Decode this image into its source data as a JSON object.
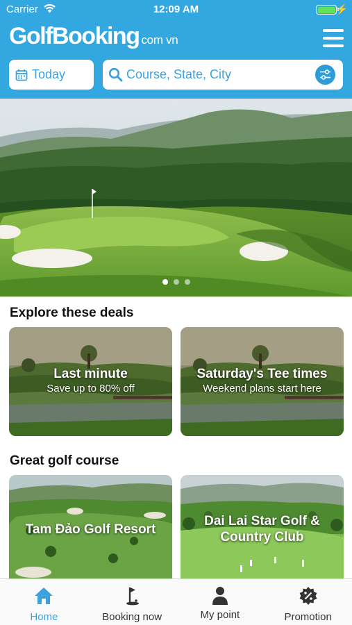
{
  "status_bar": {
    "carrier": "Carrier",
    "time": "12:09 AM",
    "battery_level": 1.0
  },
  "header": {
    "logo_main": "GolfBooking",
    "logo_sub": "com vn",
    "date_value": "Today",
    "search_placeholder": "Course, State, City"
  },
  "hero": {
    "slide_count": 3,
    "active_slide": 1
  },
  "deals": {
    "title": "Explore these deals",
    "cards": [
      {
        "title": "Last minute",
        "subtitle": "Save up to 80% off"
      },
      {
        "title": "Saturday's Tee times",
        "subtitle": "Weekend plans start here"
      }
    ]
  },
  "courses": {
    "title": "Great golf course",
    "cards": [
      {
        "title": "Tam Đảo Golf Resort"
      },
      {
        "title_line1": "Dai Lai Star Golf &",
        "title_line2": "Country Club"
      }
    ]
  },
  "tabbar": {
    "items": [
      {
        "label": "Home",
        "icon": "home-icon",
        "active": true
      },
      {
        "label": "Booking now",
        "icon": "golf-flag-icon",
        "active": false
      },
      {
        "label": "My point",
        "icon": "person-icon",
        "active": false
      },
      {
        "label": "Promotion",
        "icon": "discount-badge-icon",
        "active": false
      }
    ]
  },
  "colors": {
    "brand": "#33a7e0",
    "accent": "#3aa3de",
    "text": "#111111"
  }
}
